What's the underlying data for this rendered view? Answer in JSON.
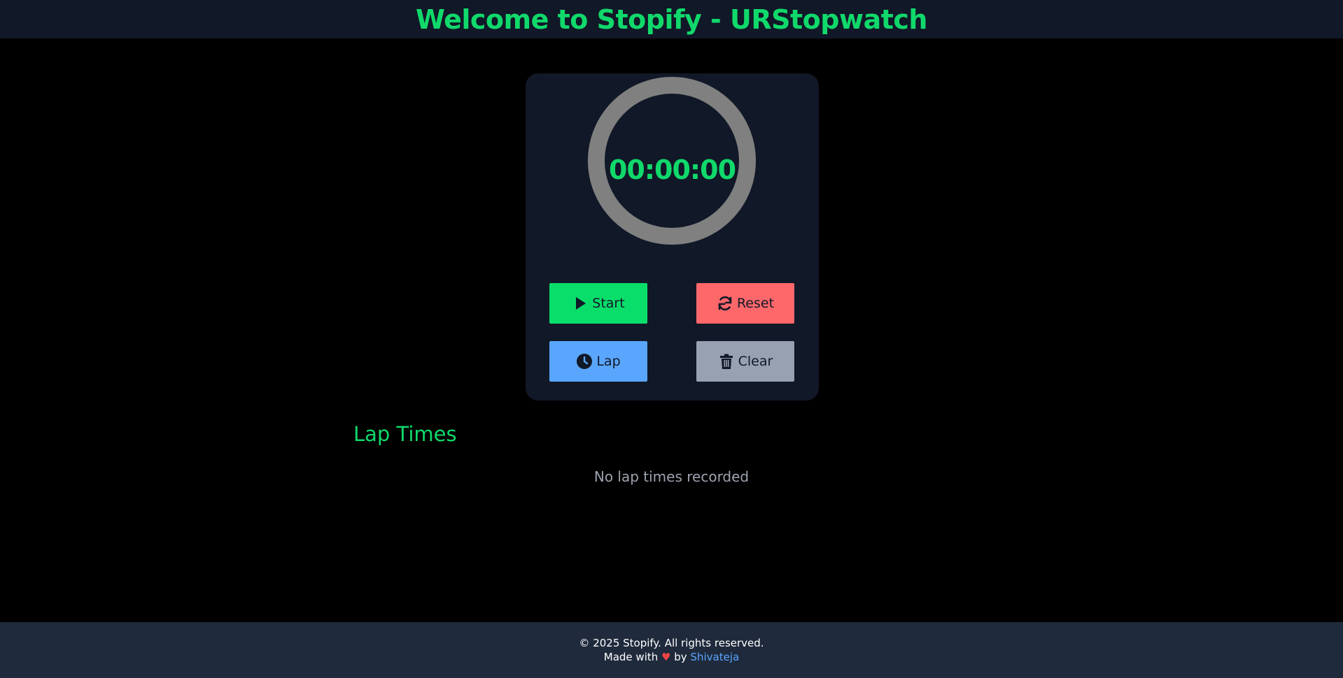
{
  "header": {
    "title": "Welcome to Stopify - URStopwatch"
  },
  "stopwatch": {
    "time": "00:00:00"
  },
  "buttons": {
    "start": {
      "label": "Start",
      "icon": "play-icon",
      "color": "#0ade6a"
    },
    "reset": {
      "label": "Reset",
      "icon": "refresh-icon",
      "color": "#ff686b"
    },
    "lap": {
      "label": "Lap",
      "icon": "clock-icon",
      "color": "#5aa6ff"
    },
    "clear": {
      "label": "Clear",
      "icon": "trash-icon",
      "color": "#98a1b1"
    }
  },
  "laps": {
    "heading": "Lap Times",
    "empty_message": "No lap times recorded",
    "items": []
  },
  "footer": {
    "copyright": "© 2025 Stopify. All rights reserved.",
    "made_with": "Made with",
    "heart": "♥",
    "by": "by",
    "author": "Shivateja"
  },
  "colors": {
    "accent": "#10d96b",
    "panel": "#111827",
    "ring": "#808080",
    "footer_bg": "#1f2a3c",
    "link": "#5aa6ff",
    "heart": "#ef4444"
  }
}
